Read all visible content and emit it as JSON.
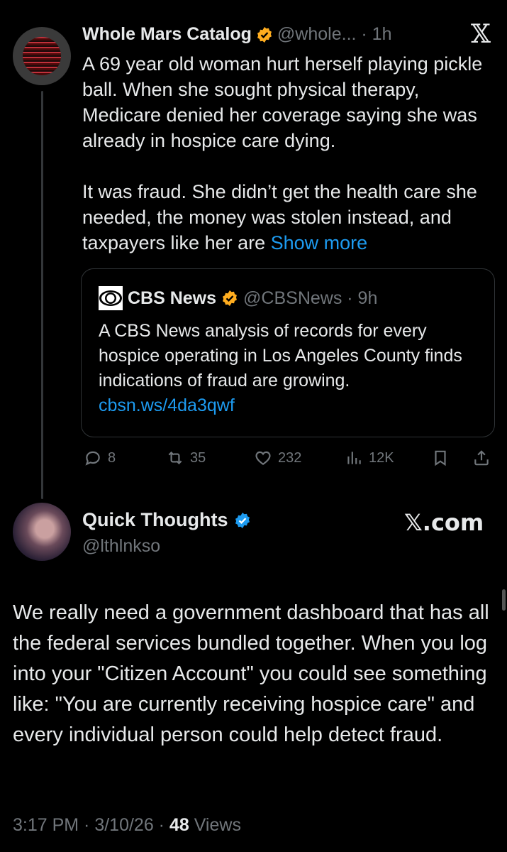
{
  "parent_tweet": {
    "author_name": "Whole Mars Catalog",
    "handle_time": "@whole... · 1h",
    "text": "A 69 year old woman hurt herself playing pickle ball. When she sought physical therapy, Medicare denied her coverage saying she was already in hospice care dying.\n\nIt was fraud. She didn’t get the health care she needed, the money was stolen instead, and taxpayers like her are ",
    "show_more": "Show more",
    "quote": {
      "author_name": "CBS News",
      "handle_time": "@CBSNews · 9h",
      "text": "A CBS News analysis of records for every hospice operating in Los Angeles County finds indications of fraud are growing.",
      "link": "cbsn.ws/4da3qwf"
    },
    "stats": {
      "replies": "8",
      "reposts": "35",
      "likes": "232",
      "views": "12K"
    }
  },
  "reply_tweet": {
    "author_name": "Quick Thoughts",
    "handle": "@lthlnkso",
    "watermark": "𝕏.com",
    "text": "We really need a government dashboard that has all the federal services bundled together. When you log into your \"Citizen Account\" you could see something like: \"You are currently receiving hospice care\" and every individual person could help detect fraud.",
    "timestamp": "3:17 PM · 3/10/26 · ",
    "view_count": "48",
    "views_label": " Views"
  },
  "colors": {
    "background": "#000000",
    "text": "#e7e9ea",
    "muted": "#71767b",
    "link": "#1d9bf0",
    "verified": "#ffad1f"
  },
  "icons": [
    "x-logo-icon",
    "verified-badge-icon",
    "cbs-eye-logo-icon",
    "reply-icon",
    "repost-icon",
    "like-icon",
    "views-icon",
    "bookmark-icon",
    "share-icon"
  ]
}
